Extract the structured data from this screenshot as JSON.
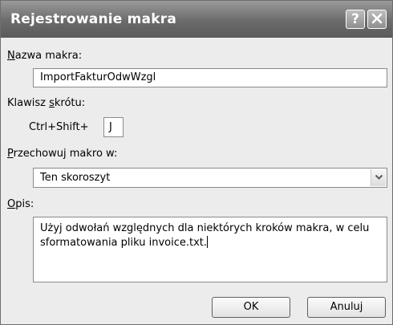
{
  "dialog": {
    "title": "Rejestrowanie makra",
    "help_symbol": "?"
  },
  "macro_name": {
    "label_access": "N",
    "label_rest": "azwa makra:",
    "value": "ImportFakturOdwWzgl"
  },
  "shortcut": {
    "label_before": "Klawisz ",
    "label_access": "s",
    "label_after": "krótu:",
    "prefix": "Ctrl+Shift+",
    "value": "J"
  },
  "store_in": {
    "label_access": "P",
    "label_rest": "rzechowuj makro w:",
    "selected": "Ten skoroszyt"
  },
  "description": {
    "label_access": "O",
    "label_rest": "pis:",
    "value": "Użyj odwołań względnych dla niektórych kroków makra, w celu sformatowania pliku invoice.txt."
  },
  "buttons": {
    "ok": "OK",
    "cancel": "Anuluj"
  }
}
